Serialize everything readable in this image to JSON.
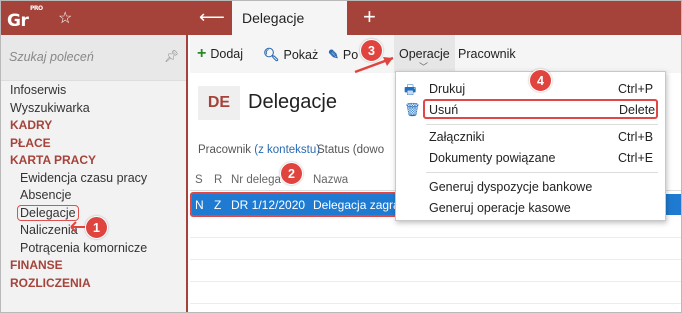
{
  "app": {
    "logo_main": "Gr",
    "logo_sup": "PRO"
  },
  "topbar": {
    "active_tab": "Delegacje"
  },
  "sidebar": {
    "search_placeholder": "Szukaj poleceń",
    "items": [
      {
        "label": "Infoserwis",
        "type": "item"
      },
      {
        "label": "Wyszukiwarka",
        "type": "item"
      },
      {
        "label": "KADRY",
        "type": "section"
      },
      {
        "label": "PŁACE",
        "type": "section"
      },
      {
        "label": "KARTA PRACY",
        "type": "section"
      },
      {
        "label": "Ewidencja czasu pracy",
        "type": "sub"
      },
      {
        "label": "Absencje",
        "type": "sub"
      },
      {
        "label": "Delegacje",
        "type": "sub-active"
      },
      {
        "label": "Naliczenia",
        "type": "sub"
      },
      {
        "label": "Potrącenia komornicze",
        "type": "sub"
      },
      {
        "label": "FINANSE",
        "type": "section"
      },
      {
        "label": "ROZLICZENIA",
        "type": "section"
      }
    ]
  },
  "toolbar": {
    "add": "Dodaj",
    "show": "Pokaż",
    "edit": "Po",
    "operations": "Operacje",
    "employee": "Pracownik"
  },
  "header": {
    "badge": "DE",
    "title": "Delegacje"
  },
  "filter": {
    "employee_prefix": "Pracownik",
    "employee_link": "(z kontekstu)",
    "status": "Status (dowo"
  },
  "table": {
    "columns": [
      "S",
      "R",
      "Nr delega",
      "Nazwa"
    ],
    "row": {
      "s": "N",
      "r": "Z",
      "nr": "DR 1/12/2020",
      "name": "Delegacja zagra"
    }
  },
  "menu": {
    "items": [
      {
        "label": "Drukuj",
        "shortcut": "Ctrl+P",
        "icon": "printer-icon"
      },
      {
        "label": "Usuń",
        "shortcut": "Delete",
        "icon": "trash-icon"
      },
      {
        "label": "Załączniki",
        "shortcut": "Ctrl+B"
      },
      {
        "label": "Dokumenty powiązane",
        "shortcut": "Ctrl+E"
      },
      {
        "label": "Generuj dyspozycje bankowe",
        "shortcut": ""
      },
      {
        "label": "Generuj operacje kasowe",
        "shortcut": ""
      }
    ]
  },
  "callouts": [
    "1",
    "2",
    "3",
    "4"
  ],
  "colors": {
    "brand": "#a5433a",
    "selection": "#1f7bd1",
    "callout": "#e0443f"
  }
}
